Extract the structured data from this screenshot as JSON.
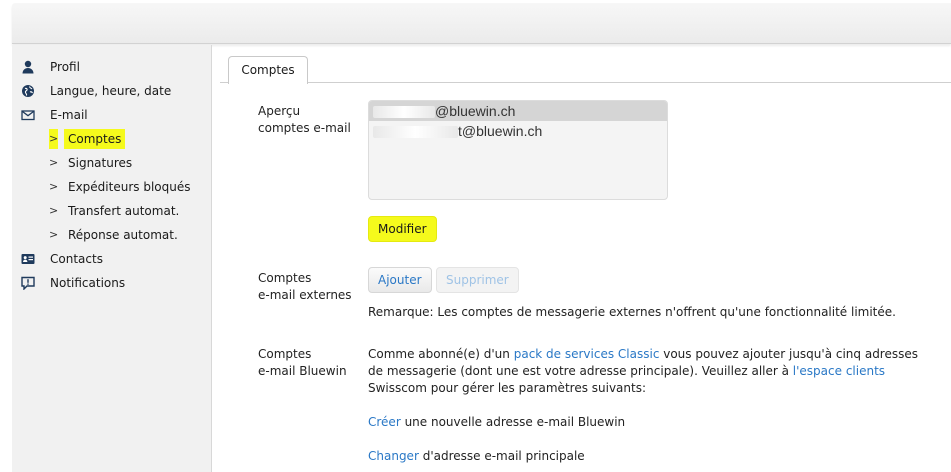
{
  "sidebar": {
    "items": [
      {
        "label": "Profil",
        "icon": "person-icon"
      },
      {
        "label": "Langue, heure, date",
        "icon": "globe-icon"
      },
      {
        "label": "E-mail",
        "icon": "envelope-icon"
      },
      {
        "label": "Comptes",
        "sub": true,
        "active": true
      },
      {
        "label": "Signatures",
        "sub": true
      },
      {
        "label": "Expéditeurs bloqués",
        "sub": true
      },
      {
        "label": "Transfert automat.",
        "sub": true
      },
      {
        "label": "Réponse automat.",
        "sub": true
      },
      {
        "label": "Contacts",
        "icon": "contact-card-icon"
      },
      {
        "label": "Notifications",
        "icon": "notification-icon"
      }
    ],
    "chevron": ">"
  },
  "tabs": [
    {
      "label": "Comptes"
    }
  ],
  "overview": {
    "label_line1": "Aperçu",
    "label_line2": "comptes e-mail",
    "accounts": [
      "@bluewin.ch",
      "t@bluewin.ch"
    ],
    "modify_label": "Modifier"
  },
  "external": {
    "label_line1": "Comptes",
    "label_line2": "e-mail externes",
    "add_label": "Ajouter",
    "remove_label": "Supprimer",
    "note": "Remarque: Les comptes de messagerie externes n'offrent qu'une fonctionnalité limitée."
  },
  "bluewin": {
    "label_line1": "Comptes",
    "label_line2": "e-mail Bluewin",
    "p1_a": "Comme abonné(e) d'un ",
    "p1_link1": "pack de services Classic",
    "p1_b": " vous pouvez ajouter jusqu'à cinq adresses de messagerie (dont une est votre adresse principale). Veuillez aller à ",
    "p1_link2": "l'espace clients",
    "p1_c": " Swisscom pour gérer les paramètres suivants:",
    "create_link": "Créer",
    "create_text": " une nouvelle adresse e-mail Bluewin",
    "change_link": "Changer",
    "change_text": " d'adresse e-mail principale"
  },
  "colors": {
    "link": "#2a78c6",
    "highlight": "#f5fa1c",
    "sidebar_bg": "#f1f1f1"
  }
}
